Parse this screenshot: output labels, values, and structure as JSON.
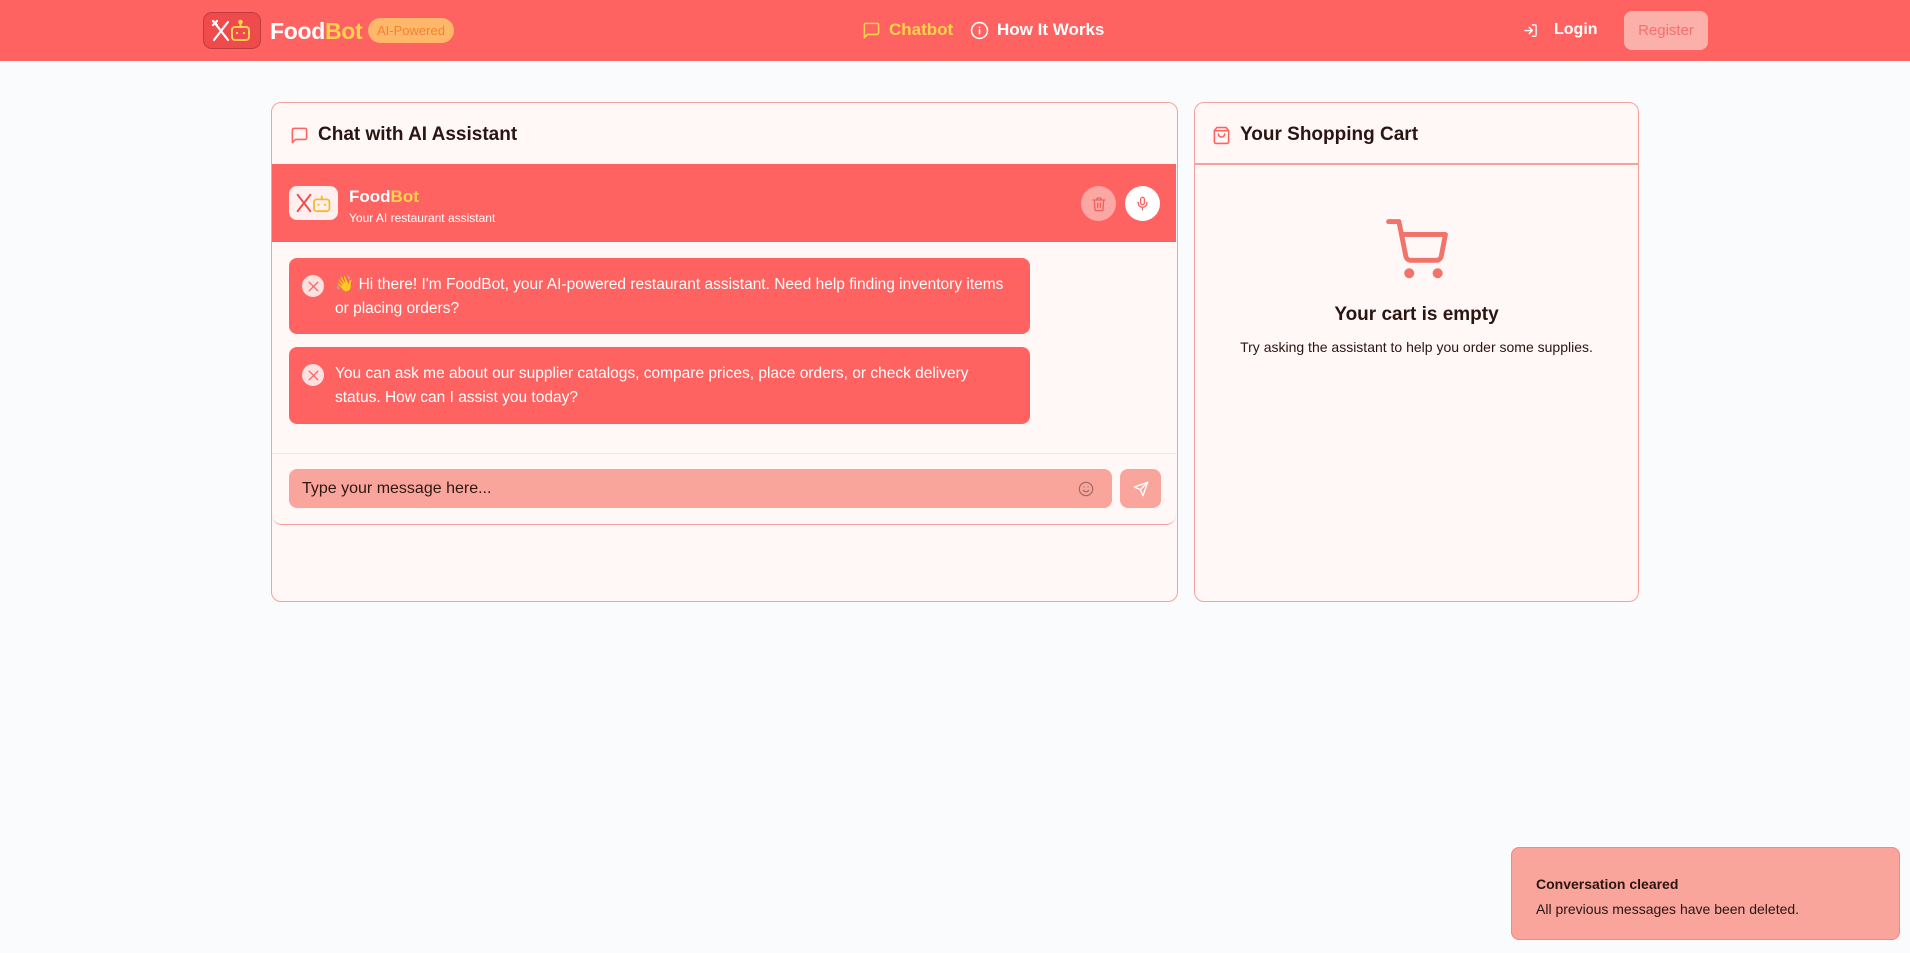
{
  "navbar": {
    "brand_part1": "Food",
    "brand_part2": "Bot",
    "badge": "AI-Powered",
    "links": {
      "chatbot": "Chatbot",
      "how_it_works": "How It Works",
      "login": "Login"
    },
    "register_label": "Register"
  },
  "chat_panel": {
    "title": "Chat with AI Assistant",
    "header": {
      "name_part1": "Food",
      "name_part2": "Bot",
      "subtitle": "Your AI restaurant assistant"
    },
    "messages": [
      {
        "text": "👋 Hi there! I'm FoodBot, your AI-powered restaurant assistant. Need help finding inventory items or placing orders?"
      },
      {
        "text": "You can ask me about our supplier catalogs, compare prices, place orders, or check delivery status. How can I assist you today?"
      }
    ],
    "input": {
      "placeholder": "Type your message here...",
      "value": ""
    }
  },
  "cart_panel": {
    "title": "Your Shopping Cart",
    "empty_title": "Your cart is empty",
    "empty_subtitle": "Try asking the assistant to help you order some supplies."
  },
  "toast": {
    "title": "Conversation cleared",
    "message": "All previous messages have been deleted."
  },
  "colors": {
    "primary": "#fe6361",
    "accent_yellow": "#ffd24d",
    "panel_bg": "#fff8f7",
    "panel_border": "#f7a19c",
    "input_bg": "#f9a59c"
  },
  "icons": {
    "logo": "utensils-robot-icon",
    "chatbot": "message-square-icon",
    "how_it_works": "info-circle-icon",
    "login": "log-in-icon",
    "trash": "trash-icon",
    "mic": "microphone-icon",
    "emoji": "smile-icon",
    "send": "send-icon",
    "cart": "shopping-cart-icon",
    "shopping_bag": "shopping-bag-icon"
  }
}
